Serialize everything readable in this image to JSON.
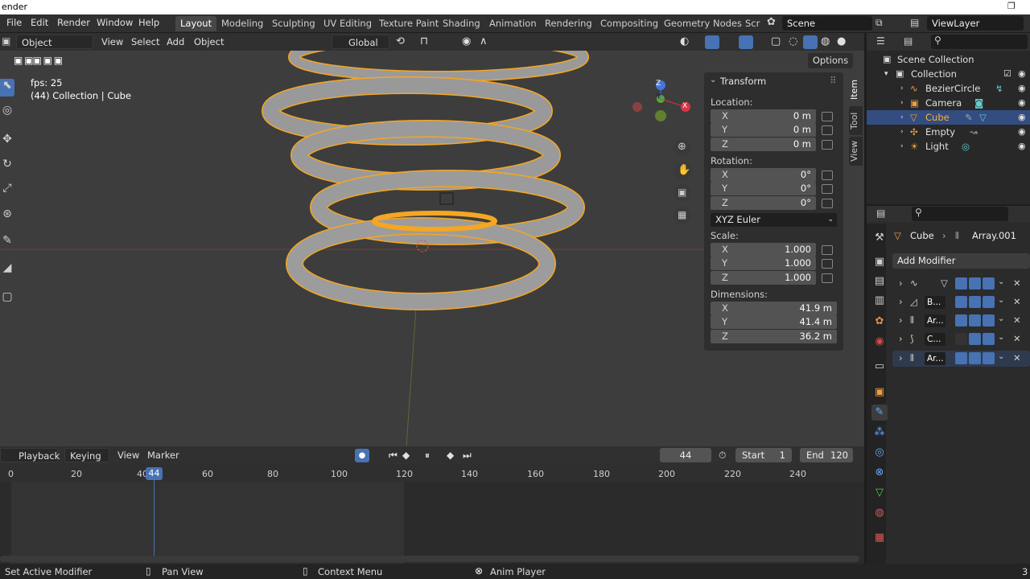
{
  "titlebar": {
    "title": "ender",
    "restore": "❐"
  },
  "topbar": {
    "menus": [
      "File",
      "Edit",
      "Render",
      "Window",
      "Help"
    ],
    "workspaces": [
      "Layout",
      "Modeling",
      "Sculpting",
      "UV Editing",
      "Texture Paint",
      "Shading",
      "Animation",
      "Rendering",
      "Compositing",
      "Geometry Nodes",
      "Scr"
    ],
    "scene": "Scene",
    "view_layer": "ViewLayer"
  },
  "viewport_header": {
    "mode": "Object Mode",
    "menus": [
      "View",
      "Select",
      "Add",
      "Object"
    ],
    "transform_orientation": "Global",
    "options": "Options"
  },
  "viewport": {
    "fps": "fps: 25",
    "info": "(44) Collection | Cube",
    "gizmo": {
      "z": "Z",
      "y": "Y",
      "x": "X"
    }
  },
  "npanel": {
    "title": "Transform",
    "location_label": "Location:",
    "location": [
      {
        "ax": "X",
        "v": "0 m"
      },
      {
        "ax": "Y",
        "v": "0 m"
      },
      {
        "ax": "Z",
        "v": "0 m"
      }
    ],
    "rotation_label": "Rotation:",
    "rotation": [
      {
        "ax": "X",
        "v": "0°"
      },
      {
        "ax": "Y",
        "v": "0°"
      },
      {
        "ax": "Z",
        "v": "0°"
      }
    ],
    "rotation_mode": "XYZ Euler",
    "scale_label": "Scale:",
    "scale": [
      {
        "ax": "X",
        "v": "1.000"
      },
      {
        "ax": "Y",
        "v": "1.000"
      },
      {
        "ax": "Z",
        "v": "1.000"
      }
    ],
    "dimensions_label": "Dimensions:",
    "dimensions": [
      {
        "ax": "X",
        "v": "41.9 m"
      },
      {
        "ax": "Y",
        "v": "41.4 m"
      },
      {
        "ax": "Z",
        "v": "36.2 m"
      }
    ],
    "tabs": [
      "Item",
      "Tool",
      "View"
    ]
  },
  "timeline_header": {
    "menus": [
      "Playback",
      "Keying",
      "View",
      "Marker"
    ],
    "current_frame": "44",
    "start_label": "Start",
    "start": "1",
    "end_label": "End",
    "end": "120"
  },
  "timeline": {
    "ticks": [
      "0",
      "20",
      "40",
      "60",
      "80",
      "100",
      "120",
      "140",
      "160",
      "180",
      "200",
      "220",
      "240"
    ],
    "playhead": "44"
  },
  "outliner": {
    "root": "Scene Collection",
    "collection": "Collection",
    "items": [
      "BezierCircle",
      "Camera",
      "Cube",
      "Empty",
      "Light"
    ]
  },
  "properties": {
    "object": "Cube",
    "modifier_path": "Array.001",
    "add_modifier": "Add Modifier",
    "modifiers": [
      "",
      "B...",
      "Ar...",
      "C...",
      "Ar..."
    ]
  },
  "statusbar": {
    "left": "Set Active Modifier",
    "pan": "Pan View",
    "context": "Context Menu",
    "anim": "Anim Player",
    "right": "3"
  },
  "colors": {
    "accent": "#4772b3",
    "selected_outline": "#f5a623",
    "active_tab": "#474747"
  }
}
